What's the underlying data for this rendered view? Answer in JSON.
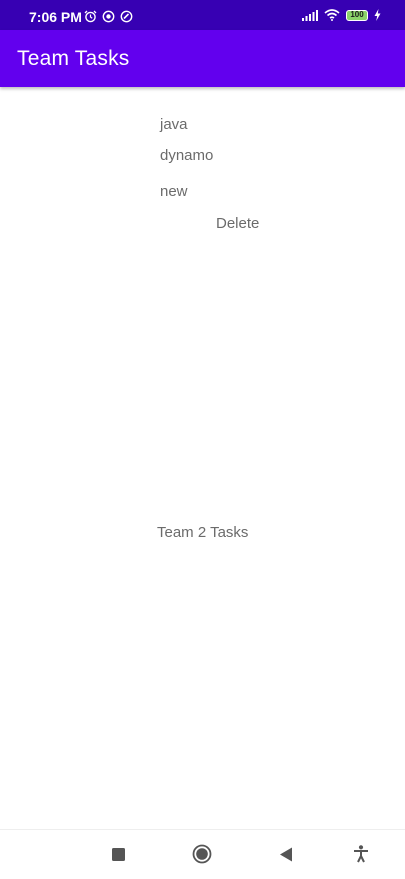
{
  "status_bar": {
    "time": "7:06 PM",
    "battery_level": "100",
    "left_icons": [
      "alarm-icon",
      "data-saver-icon",
      "vpn-icon"
    ],
    "right_icons": [
      "signal-icon",
      "wifi-icon",
      "battery-icon",
      "charging-icon"
    ]
  },
  "app_bar": {
    "title": "Team Tasks",
    "color": "#6200ee"
  },
  "tasks": [
    {
      "title": "java"
    },
    {
      "title": "dynamo"
    },
    {
      "title": "new"
    }
  ],
  "actions": {
    "delete_label": "Delete"
  },
  "team_section": {
    "label": "Team 2 Tasks"
  },
  "nav_bar": {
    "buttons": [
      "recents-square-icon",
      "home-circle-icon",
      "back-triangle-icon",
      "accessibility-icon"
    ]
  },
  "colors": {
    "status_bar": "#3700b3",
    "app_bar": "#6200ee",
    "text_secondary": "#6b6b6b"
  }
}
